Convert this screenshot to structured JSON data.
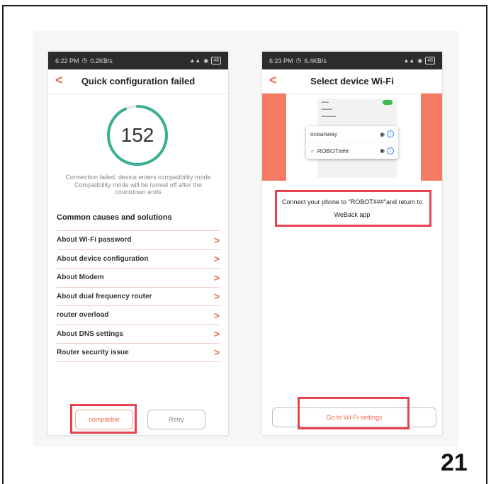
{
  "page_number": "21",
  "left_phone": {
    "status": {
      "time": "6:22 PM",
      "speed": "0.2KB/s",
      "battery": "48"
    },
    "title": "Quick configuration failed",
    "countdown": {
      "value": "152",
      "progress": 0.93
    },
    "failure_message": "Connection failed, device enters compatibility mode Compatibility mode will be turned off after the countdown ends",
    "causes_heading": "Common causes and solutions",
    "causes": [
      "About Wi-Fi password",
      "About device configuration",
      "About Modem",
      "About dual frequency router",
      "router overload",
      "About DNS settings",
      "Router security issue"
    ],
    "buttons": {
      "compatible": "compatible",
      "retry": "Retry"
    }
  },
  "right_phone": {
    "status": {
      "time": "6:23 PM",
      "speed": "6.4KB/s",
      "battery": "48"
    },
    "title": "Select device Wi-Fi",
    "wifi_list": [
      {
        "name": "oceanway",
        "selected": false
      },
      {
        "name": "ROBOT###",
        "selected": true
      }
    ],
    "instruction": "Connect your phone to \"ROBOT###\"and return to WeBack app",
    "button": "Go to Wi-Fi settings"
  },
  "colors": {
    "accent": "#f06a4f",
    "highlight": "#e8424f",
    "ring": "#3aaf93"
  }
}
